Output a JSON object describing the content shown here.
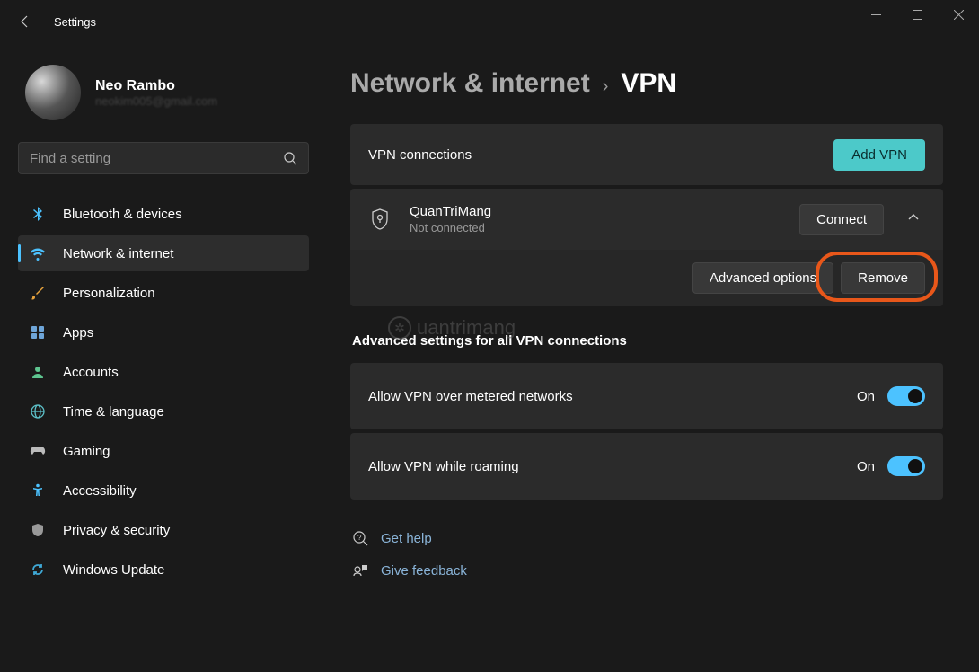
{
  "app_title": "Settings",
  "profile": {
    "name": "Neo Rambo",
    "email": "neokim005@gmail.com"
  },
  "search": {
    "placeholder": "Find a setting"
  },
  "nav": [
    {
      "icon": "bluetooth",
      "label": "Bluetooth & devices",
      "color": "#4cc2ff"
    },
    {
      "icon": "wifi",
      "label": "Network & internet",
      "color": "#4cc2ff",
      "active": true
    },
    {
      "icon": "brush",
      "label": "Personalization",
      "color": "#e8a33d"
    },
    {
      "icon": "apps",
      "label": "Apps",
      "color": "#6ea5d8"
    },
    {
      "icon": "person",
      "label": "Accounts",
      "color": "#5ec48f"
    },
    {
      "icon": "globe",
      "label": "Time & language",
      "color": "#5dc1c9"
    },
    {
      "icon": "gamepad",
      "label": "Gaming",
      "color": "#bbb"
    },
    {
      "icon": "accessibility",
      "label": "Accessibility",
      "color": "#4cc2ff"
    },
    {
      "icon": "shield",
      "label": "Privacy & security",
      "color": "#999"
    },
    {
      "icon": "update",
      "label": "Windows Update",
      "color": "#3fa9d6"
    }
  ],
  "breadcrumb": {
    "parent": "Network & internet",
    "current": "VPN"
  },
  "vpn_section": {
    "header": "VPN connections",
    "add_button": "Add VPN",
    "connection": {
      "name": "QuanTriMang",
      "status": "Not connected",
      "connect_btn": "Connect",
      "advanced_btn": "Advanced options",
      "remove_btn": "Remove"
    }
  },
  "advanced": {
    "heading": "Advanced settings for all VPN connections",
    "toggles": [
      {
        "label": "Allow VPN over metered networks",
        "state": "On"
      },
      {
        "label": "Allow VPN while roaming",
        "state": "On"
      }
    ]
  },
  "footer": {
    "help": "Get help",
    "feedback": "Give feedback"
  },
  "watermark": "uantrimang"
}
